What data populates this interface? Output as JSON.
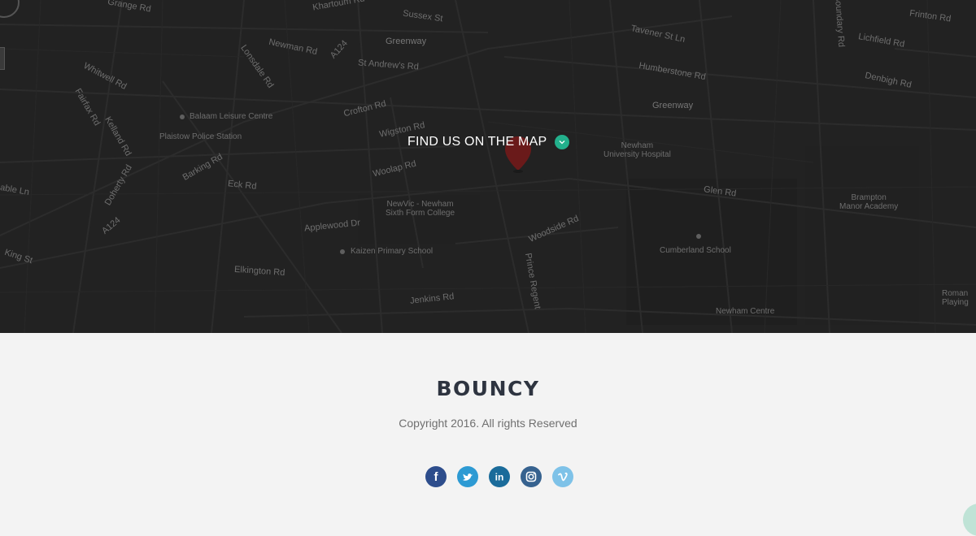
{
  "map": {
    "cta_label": "FIND US ON THE MAP",
    "accent_color": "#23b08c",
    "pin_color": "#6a1a1a",
    "labels": {
      "grange_rd": "Grange Rd",
      "khartoum_rd": "Khartoum Rd",
      "sussex_st": "Sussex St",
      "newman_rd": "Newman Rd",
      "a124_top": "A124",
      "greenway_top": "Greenway",
      "st_andrews_rd": "St Andrew's Rd",
      "whitwell_rd": "Whitwell Rd",
      "lonsdale_rd": "Lonsdale Rd",
      "tavener_st_ln": "Tavener St Ln",
      "humberstone_rd": "Humberstone Rd",
      "frinton_rd": "Frinton Rd",
      "lichfield_rd": "Lichfield Rd",
      "denbigh_rd": "Denbigh Rd",
      "greenway_right": "Greenway",
      "balaam_leisure": "Balaam Leisure Centre",
      "croftor_rd": "Crofton Rd",
      "plaistow_police": "Plaistow Police Station",
      "wigston_rd": "Wigston Rd",
      "newham_hospital": "Newham\nUniversity Hospital",
      "barking_rd": "Barking Rd",
      "woolap_rd": "Woolap Rd",
      "eck_rd": "Eck Rd",
      "glen_rd": "Glen Rd",
      "brampton_manor": "Brampton\nManor Academy",
      "newvic": "NewVic - Newham\nSixth Form College",
      "appleswood_dr": "Applewood Dr",
      "woodside_rd": "Woodside Rd",
      "a124_left": "A124",
      "kaizen_school": "Kaizen Primary School",
      "cumberland_school": "Cumberland School",
      "king_st": "King St",
      "elkington_rd": "Elkington Rd",
      "prince_regent": "Prince Regent",
      "jenkins_rd": "Jenkins Rd",
      "newham_centre": "Newham Centre",
      "roman_playing": "Roman\nPlaying",
      "boundary_rd": "Boundary Rd",
      "doherty_rd": "Doherty Rd",
      "kelland_rd": "Kelland Rd",
      "fairfax_rd": "Fairfax Rd",
      "able_ln": "able Ln"
    }
  },
  "footer": {
    "brand": "BOUNCY",
    "copyright": "Copyright 2016. All rights Reserved",
    "brand_color": "#2e3440"
  },
  "socials": [
    {
      "name": "facebook",
      "glyph": "f",
      "color": "#2d4d8c"
    },
    {
      "name": "twitter",
      "glyph": "t",
      "color": "#2d9ad3"
    },
    {
      "name": "linkedin",
      "glyph": "in",
      "color": "#1a6b9a"
    },
    {
      "name": "instagram",
      "glyph": "ig",
      "color": "#36628f"
    },
    {
      "name": "vimeo",
      "glyph": "v",
      "color": "#7ec2e8"
    }
  ]
}
